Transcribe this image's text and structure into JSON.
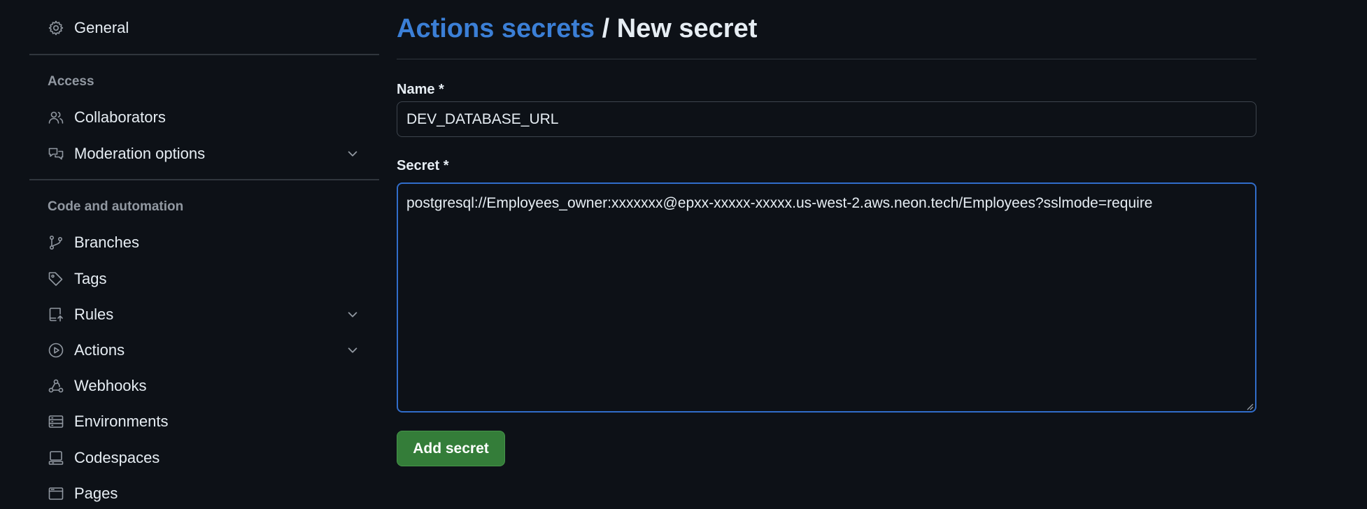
{
  "sidebar": {
    "top_item": {
      "label": "General",
      "icon": "gear-icon"
    },
    "sections": [
      {
        "heading": "Access",
        "items": [
          {
            "label": "Collaborators",
            "icon": "people-icon"
          },
          {
            "label": "Moderation options",
            "icon": "comment-discussion-icon",
            "expandable": true
          }
        ]
      },
      {
        "heading": "Code and automation",
        "items": [
          {
            "label": "Branches",
            "icon": "git-branch-icon"
          },
          {
            "label": "Tags",
            "icon": "tag-icon"
          },
          {
            "label": "Rules",
            "icon": "repo-push-icon",
            "expandable": true
          },
          {
            "label": "Actions",
            "icon": "play-icon",
            "expandable": true
          },
          {
            "label": "Webhooks",
            "icon": "webhook-icon"
          },
          {
            "label": "Environments",
            "icon": "server-icon"
          },
          {
            "label": "Codespaces",
            "icon": "codespaces-icon"
          },
          {
            "label": "Pages",
            "icon": "browser-icon"
          }
        ]
      }
    ]
  },
  "header": {
    "breadcrumb_link": "Actions secrets",
    "separator": " / ",
    "title": "New secret"
  },
  "form": {
    "name_label": "Name *",
    "name_value": "DEV_DATABASE_URL",
    "secret_label": "Secret *",
    "secret_value": "postgresql://Employees_owner:xxxxxxx@epxx-xxxxx-xxxxx.us-west-2.aws.neon.tech/Employees?sslmode=require",
    "submit_label": "Add secret"
  },
  "colors": {
    "background": "#0d1117",
    "text": "#e6edf3",
    "muted": "#9198a1",
    "link": "#4493f8",
    "focus_border": "#316dca",
    "button": "#347d39"
  }
}
